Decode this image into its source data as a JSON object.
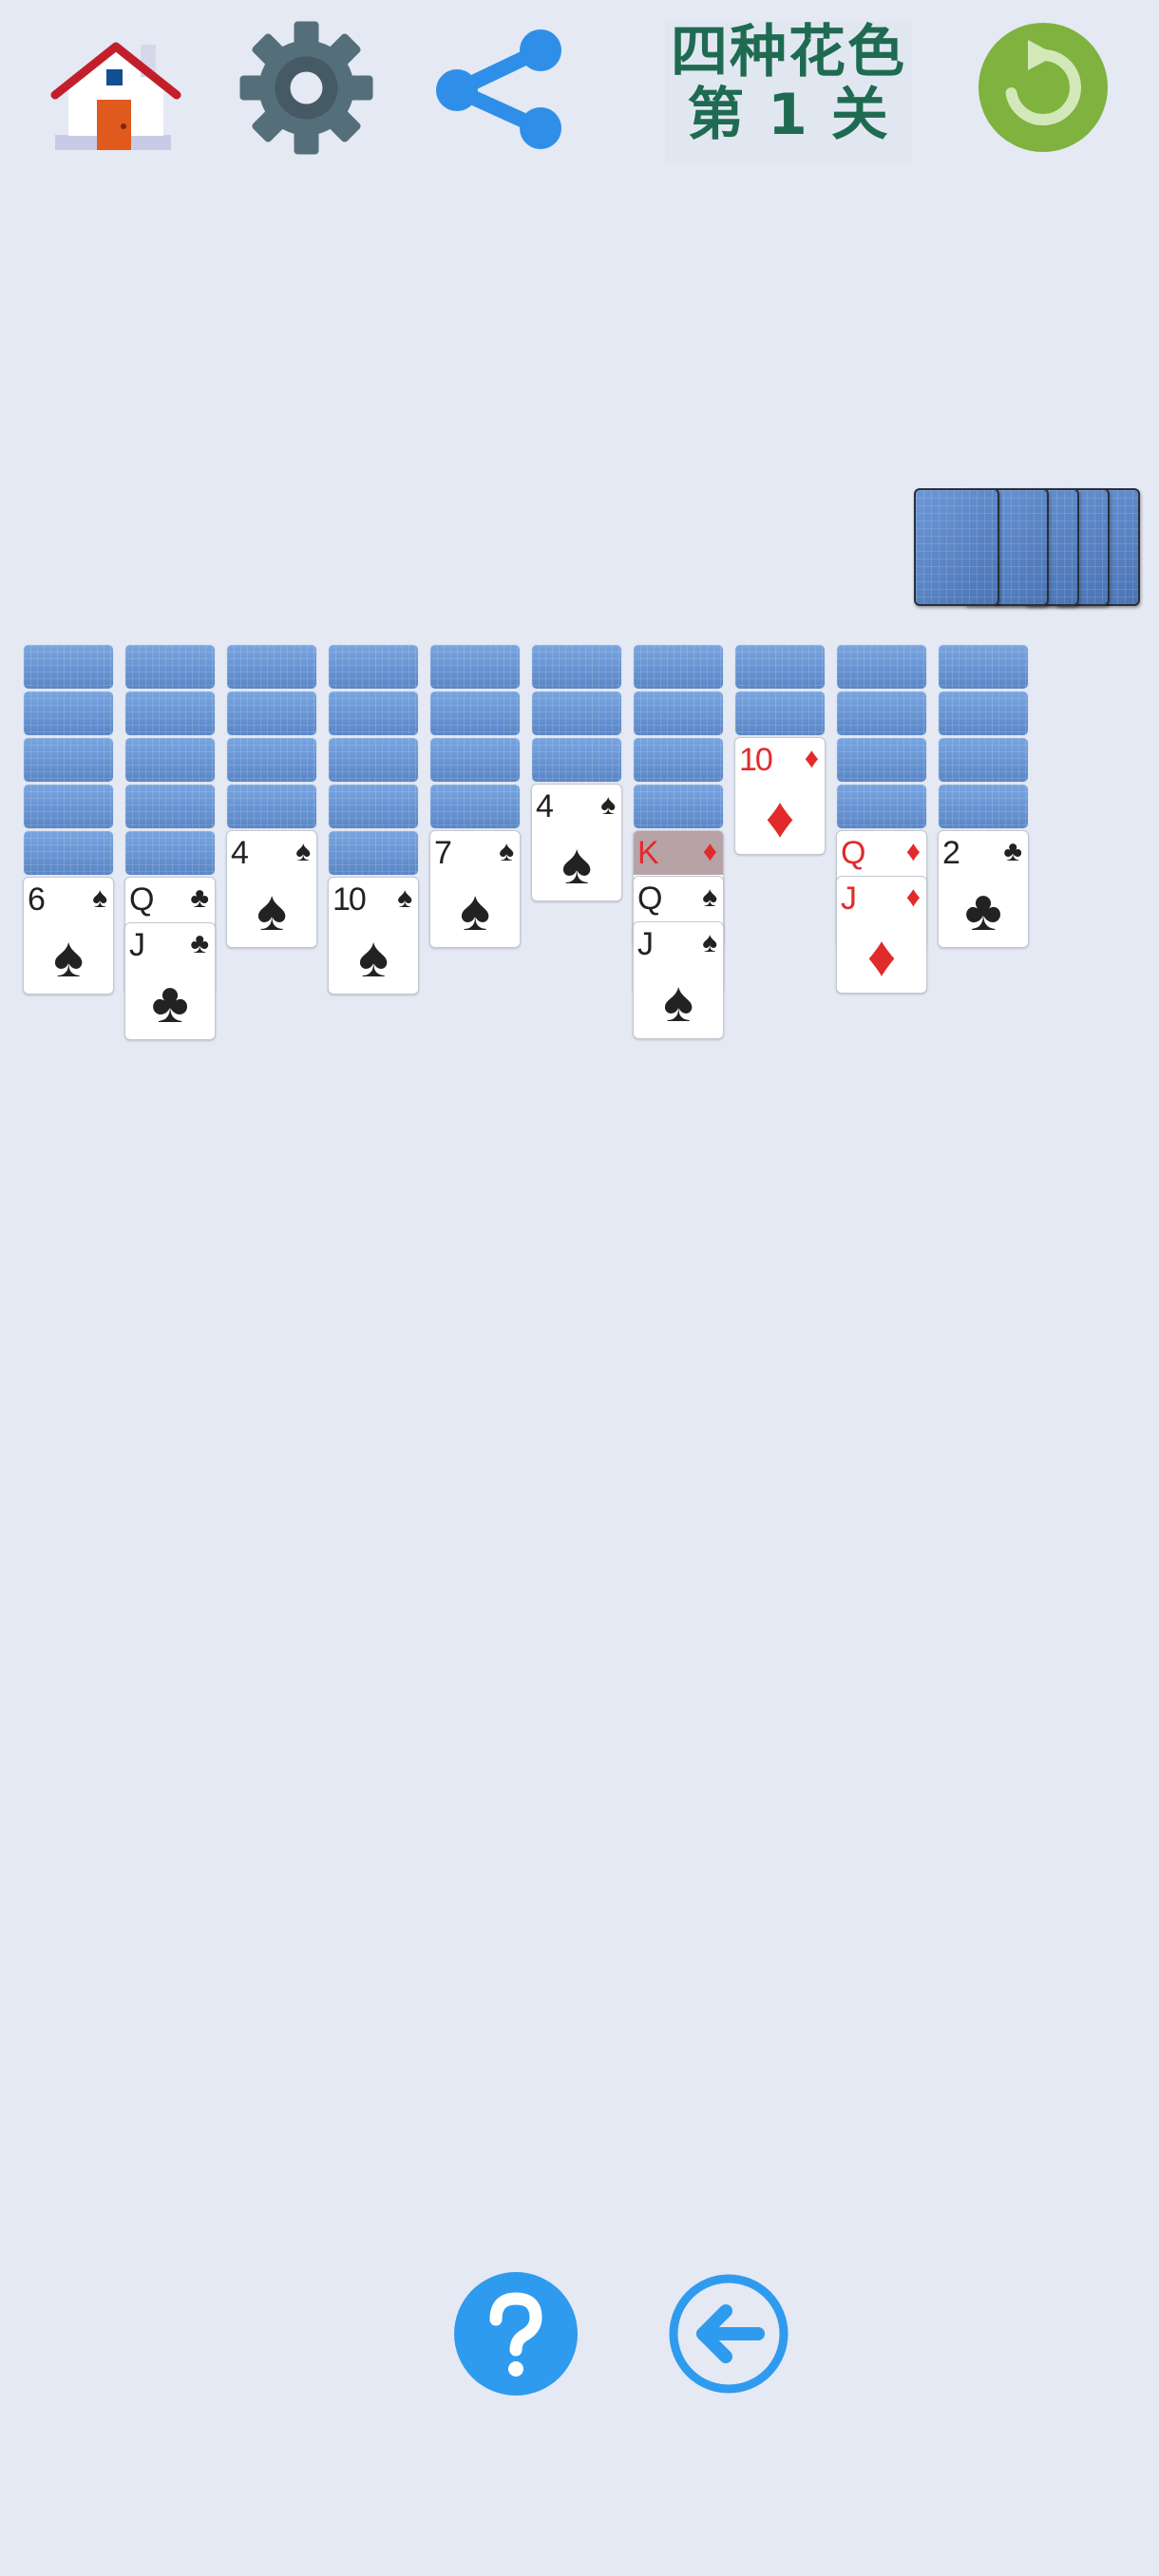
{
  "header": {
    "title_line1": "四种花色",
    "title_line2": "第 1 关",
    "icons": [
      "home-icon",
      "gear-icon",
      "share-icon",
      "restart-icon"
    ]
  },
  "footer": {
    "icons": [
      "help-icon",
      "undo-icon"
    ]
  },
  "stock": {
    "remaining_deals": 5
  },
  "tableau": [
    {
      "face_down": 5,
      "face_up": [
        {
          "rank": "6",
          "suit": "♠",
          "color": "black"
        }
      ]
    },
    {
      "face_down": 5,
      "face_up": [
        {
          "rank": "Q",
          "suit": "♣",
          "color": "black"
        },
        {
          "rank": "J",
          "suit": "♣",
          "color": "black"
        }
      ]
    },
    {
      "face_down": 4,
      "face_up": [
        {
          "rank": "4",
          "suit": "♠",
          "color": "black"
        }
      ]
    },
    {
      "face_down": 5,
      "face_up": [
        {
          "rank": "10",
          "suit": "♠",
          "color": "black"
        }
      ]
    },
    {
      "face_down": 4,
      "face_up": [
        {
          "rank": "7",
          "suit": "♠",
          "color": "black"
        }
      ]
    },
    {
      "face_down": 3,
      "face_up": [
        {
          "rank": "4",
          "suit": "♠",
          "color": "black"
        }
      ]
    },
    {
      "face_down": 4,
      "face_up": [
        {
          "rank": "K",
          "suit": "♦",
          "color": "red",
          "highlight": true
        },
        {
          "rank": "Q",
          "suit": "♠",
          "color": "black"
        },
        {
          "rank": "J",
          "suit": "♠",
          "color": "black"
        }
      ]
    },
    {
      "face_down": 2,
      "face_up": [
        {
          "rank": "10",
          "suit": "♦",
          "color": "red"
        }
      ]
    },
    {
      "face_down": 4,
      "face_up": [
        {
          "rank": "Q",
          "suit": "♦",
          "color": "red"
        },
        {
          "rank": "J",
          "suit": "♦",
          "color": "red"
        }
      ]
    },
    {
      "face_down": 4,
      "face_up": [
        {
          "rank": "2",
          "suit": "♣",
          "color": "black"
        }
      ]
    }
  ],
  "colors": {
    "background": "#e4e9f3",
    "title_text": "#1f6b52",
    "restart": "#7fb23e",
    "help": "#2f9bee",
    "undo": "#2f9bee",
    "share": "#2f8fe8",
    "gear": "#546e7a",
    "red_suit": "#e12b2b"
  }
}
